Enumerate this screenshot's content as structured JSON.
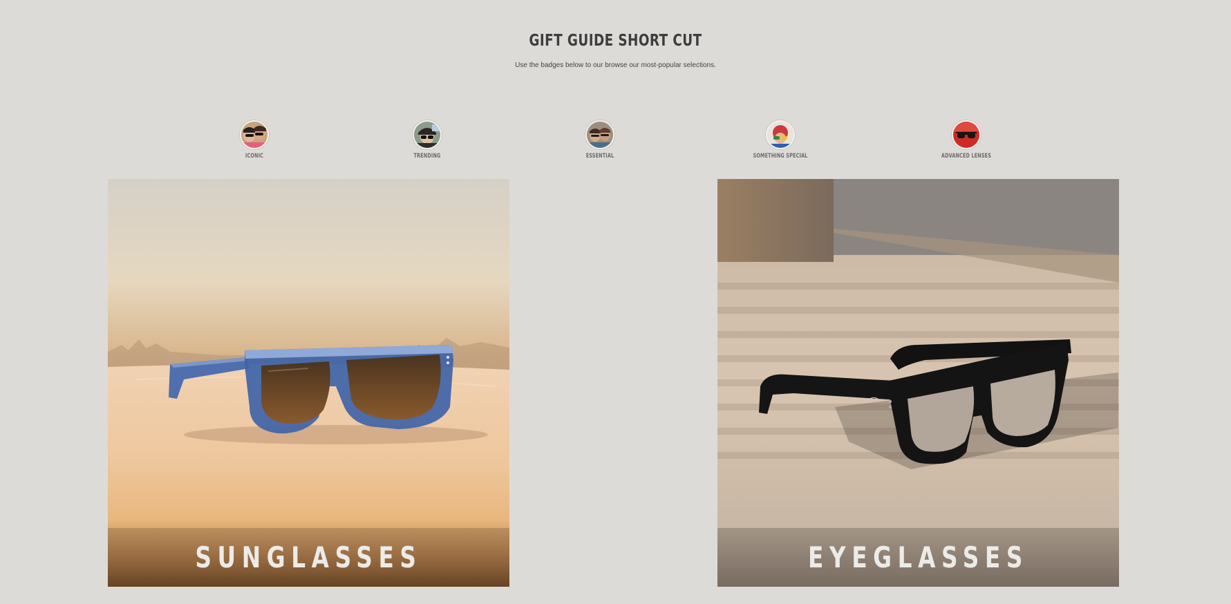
{
  "header": {
    "title": "GIFT GUIDE SHORT CUT",
    "subtitle": "Use the badges below to our browse our most-popular selections."
  },
  "badges": [
    {
      "label": "ICONIC",
      "icon": "iconic-photo-icon"
    },
    {
      "label": "TRENDING",
      "icon": "trending-photo-icon"
    },
    {
      "label": "ESSENTIAL",
      "icon": "essential-photo-icon"
    },
    {
      "label": "SOMETHING SPECIAL",
      "icon": "something-special-photo-icon"
    },
    {
      "label": "ADVANCED LENSES",
      "icon": "advanced-lenses-photo-icon"
    }
  ],
  "cards": [
    {
      "label": "SUNGLASSES",
      "image": "blue-sunglasses-on-sand"
    },
    {
      "label": "EYEGLASSES",
      "image": "black-eyeglasses-on-table"
    }
  ],
  "colors": {
    "background": "#dddbd7",
    "heading": "#3d3d3d",
    "card_label": "#ecebe8"
  }
}
